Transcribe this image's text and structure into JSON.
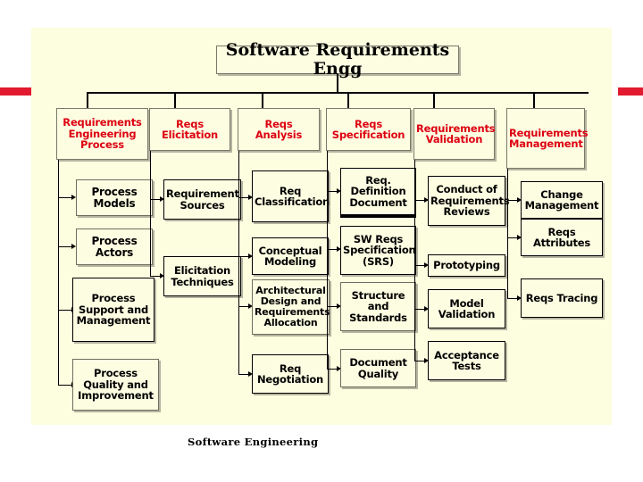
{
  "slide": {
    "background_color": "#fdfddf",
    "accent_color": "#e11a30",
    "header_text_color": "#dd0011",
    "footer": "Software Engineering"
  },
  "diagram": {
    "title": "Software Requirements Engg",
    "columns": [
      {
        "header": "Requirements Engineering Process",
        "items": [
          "Process Models",
          "Process Actors",
          "Process Support and Management",
          "Process Quality and Improvement"
        ]
      },
      {
        "header": "Reqs Elicitation",
        "items": [
          "Requirement Sources",
          "Elicitation Techniques"
        ]
      },
      {
        "header": "Reqs Analysis",
        "items": [
          "Req Classification",
          "Conceptual Modeling",
          "Architectural Design and Requirements Allocation",
          "Req Negotiation"
        ]
      },
      {
        "header": "Reqs Specification",
        "items": [
          "Req. Definition Document",
          "SW Reqs Specification (SRS)",
          "Structure and Standards",
          "Document Quality"
        ]
      },
      {
        "header": "Requirements Validation",
        "items": [
          "Conduct of Requirements Reviews",
          "Prototyping",
          "Model Validation",
          "Acceptance Tests"
        ]
      },
      {
        "header": "Requirements Management",
        "items": [
          "Change Management",
          "Reqs Attributes",
          "Reqs Tracing"
        ]
      }
    ]
  }
}
